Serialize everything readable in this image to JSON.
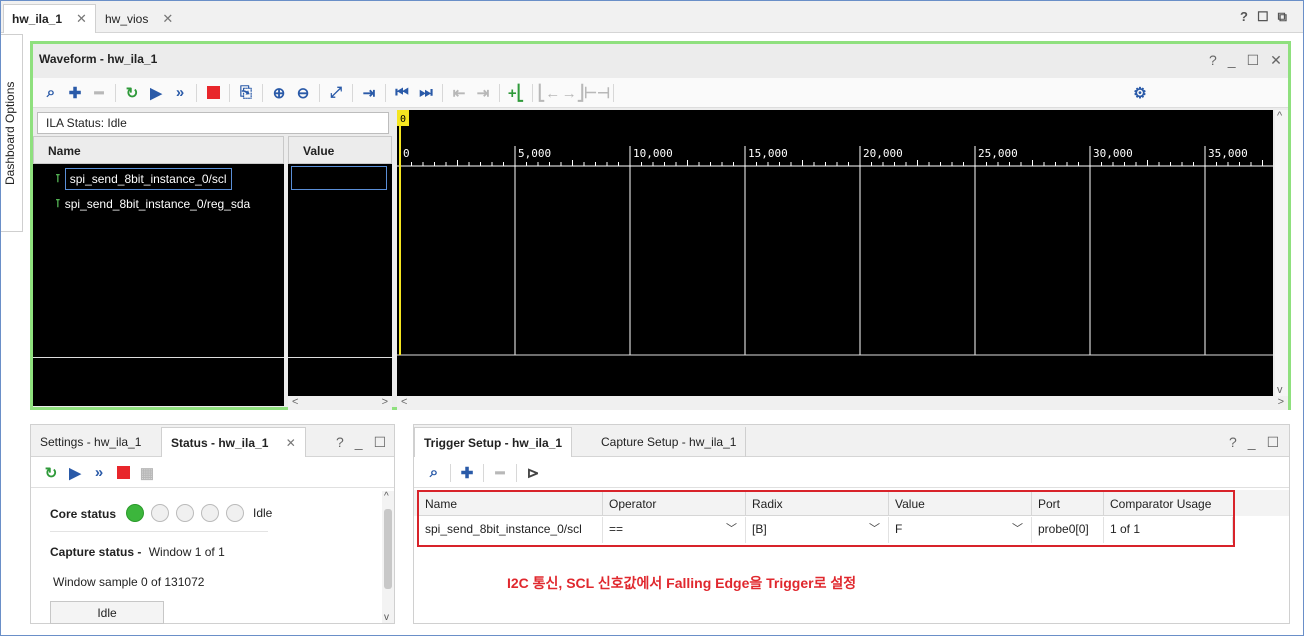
{
  "tabs": [
    {
      "label": "hw_ila_1",
      "active": true
    },
    {
      "label": "hw_vios",
      "active": false
    }
  ],
  "window_controls": [
    "?",
    "☐",
    "⧉"
  ],
  "side_tab_label": "Dashboard Options",
  "waveform": {
    "title": "Waveform - hw_ila_1",
    "controls": [
      "?",
      "_",
      "☐",
      "✕"
    ],
    "ila_status_label": "ILA Status:",
    "ila_status_value": "Idle",
    "name_header": "Name",
    "value_header": "Value",
    "signals": [
      {
        "name": "spi_send_8bit_instance_0/scl"
      },
      {
        "name": "spi_send_8bit_instance_0/reg_sda"
      }
    ],
    "cursor_label": "0",
    "ruler_ticks": [
      "0",
      "5,000",
      "10,000",
      "15,000",
      "20,000",
      "25,000",
      "30,000",
      "35,000"
    ]
  },
  "settings_status": {
    "tabs": [
      {
        "label": "Settings - hw_ila_1",
        "active": false
      },
      {
        "label": "Status - hw_ila_1",
        "active": true
      }
    ],
    "controls": [
      "?",
      "_",
      "☐"
    ],
    "core_status_label": "Core status",
    "core_status_value": "Idle",
    "capture_status_label": "Capture status -",
    "capture_status_value": "Window 1 of 1",
    "window_sample": "Window sample 0 of 131072",
    "idle_button": "Idle"
  },
  "trigger_setup": {
    "tabs": [
      {
        "label": "Trigger Setup - hw_ila_1",
        "active": true
      },
      {
        "label": "Capture Setup - hw_ila_1",
        "active": false
      }
    ],
    "controls": [
      "?",
      "_",
      "☐"
    ],
    "columns": [
      "Name",
      "Operator",
      "Radix",
      "Value",
      "Port",
      "Comparator Usage"
    ],
    "row": {
      "name": "spi_send_8bit_instance_0/scl",
      "operator": "==",
      "radix": "[B]",
      "value": "F",
      "port": "probe0[0]",
      "comparator_usage": "1 of 1"
    },
    "annotation": "I2C 통신, SCL 신호값에서 Falling Edge을 Trigger로 설정"
  },
  "colors": {
    "panel_highlight": "#8fe07e",
    "annotation": "#e0282e",
    "accent": "#2a5aa8",
    "status_on": "#3cb63c",
    "stop_red": "#e8262b"
  }
}
